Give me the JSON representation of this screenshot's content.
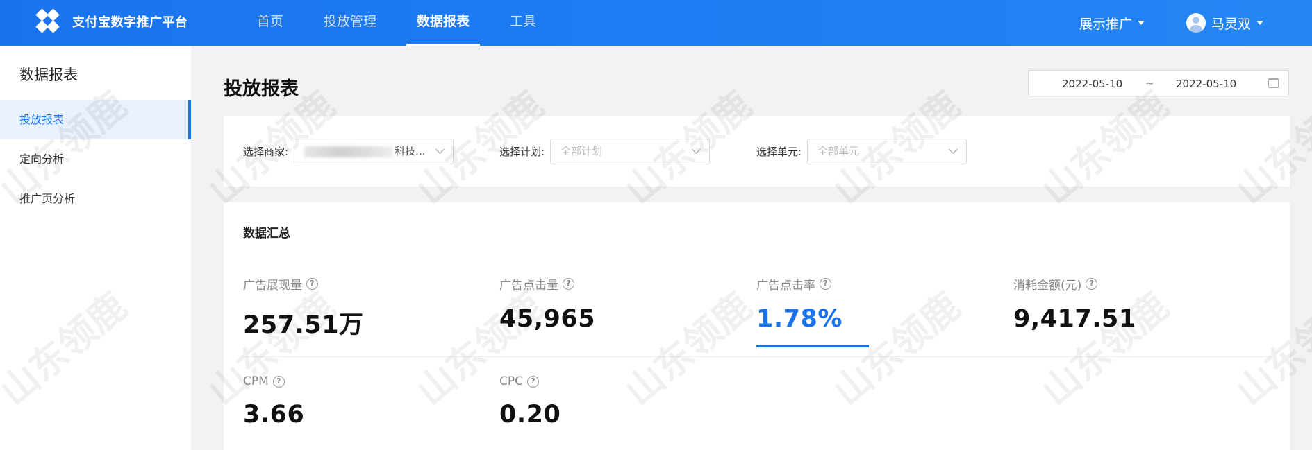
{
  "header": {
    "brand": "支付宝数字推广平台",
    "nav": [
      "首页",
      "投放管理",
      "数据报表",
      "工具"
    ],
    "active_nav": "数据报表",
    "promo_dropdown": "展示推广",
    "user_name": "马灵双"
  },
  "sidebar": {
    "title": "数据报表",
    "items": [
      {
        "label": "投放报表",
        "active": true
      },
      {
        "label": "定向分析",
        "active": false
      },
      {
        "label": "推广页分析",
        "active": false
      }
    ]
  },
  "main": {
    "title": "投放报表",
    "date_range": {
      "start": "2022-05-10",
      "separator": "~",
      "end": "2022-05-10"
    },
    "filters": {
      "merchant_label": "选择商家:",
      "merchant_value": "科技...",
      "plan_label": "选择计划:",
      "plan_placeholder": "全部计划",
      "unit_label": "选择单元:",
      "unit_placeholder": "全部单元"
    },
    "summary": {
      "title": "数据汇总",
      "metrics": [
        {
          "label": "广告展现量",
          "value": "257.51万"
        },
        {
          "label": "广告点击量",
          "value": "45,965"
        },
        {
          "label": "广告点击率",
          "value": "1.78%",
          "highlight": true
        },
        {
          "label": "消耗金额(元)",
          "value": "9,417.51"
        },
        {
          "label": "CPM",
          "value": "3.66"
        },
        {
          "label": "CPC",
          "value": "0.20"
        }
      ]
    }
  },
  "watermark": "山东领鹿",
  "colors": {
    "primary": "#1a73ee",
    "background": "#f2f2f2"
  }
}
